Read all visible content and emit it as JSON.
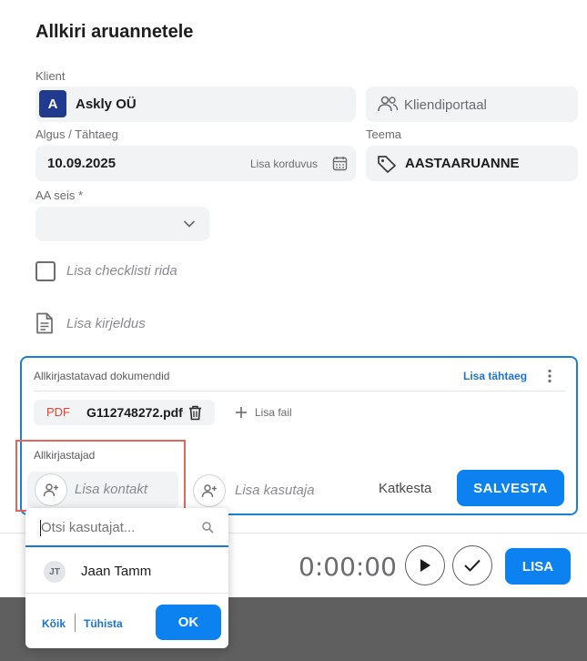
{
  "dialog": {
    "title": "Allkiri aruannetele"
  },
  "client": {
    "label": "Klient",
    "avatar_letter": "A",
    "name": "Askly OÜ",
    "portal_label": "Kliendiportaal"
  },
  "dates": {
    "label": "Algus / Tähtaeg",
    "value": "10.09.2025",
    "repeat_label": "Lisa korduvus"
  },
  "topic": {
    "label": "Teema",
    "value": "AASTAARUANNE"
  },
  "aa_status": {
    "label": "AA seis *",
    "value": ""
  },
  "checklist": {
    "placeholder": "Lisa checklisti rida"
  },
  "description": {
    "placeholder": "Lisa kirjeldus"
  },
  "documents": {
    "header": "Allkirjastatavad dokumendid",
    "deadline_link": "Lisa tähtaeg",
    "file_type": "PDF",
    "file_name": "G112748272.pdf",
    "add_file_label": "Lisa fail"
  },
  "signers": {
    "label": "Allkirjastajad",
    "add_contact_label": "Lisa kontakt",
    "add_user_label": "Lisa kasutaja",
    "cancel_label": "Katkesta",
    "save_label": "SALVESTA"
  },
  "footer": {
    "timer": "0:00:00",
    "add_label": "LISA"
  },
  "dropdown": {
    "search_placeholder": "Otsi kasutajat...",
    "items": [
      {
        "initials": "JT",
        "name": "Jaan Tamm"
      }
    ],
    "all_label": "Kõik",
    "clear_label": "Tühista",
    "ok_label": "OK"
  },
  "colors": {
    "accent": "#0b82f0",
    "highlight_border": "#e0675c",
    "avatar": "#1f3a8f",
    "pdf_red": "#e0442f"
  }
}
